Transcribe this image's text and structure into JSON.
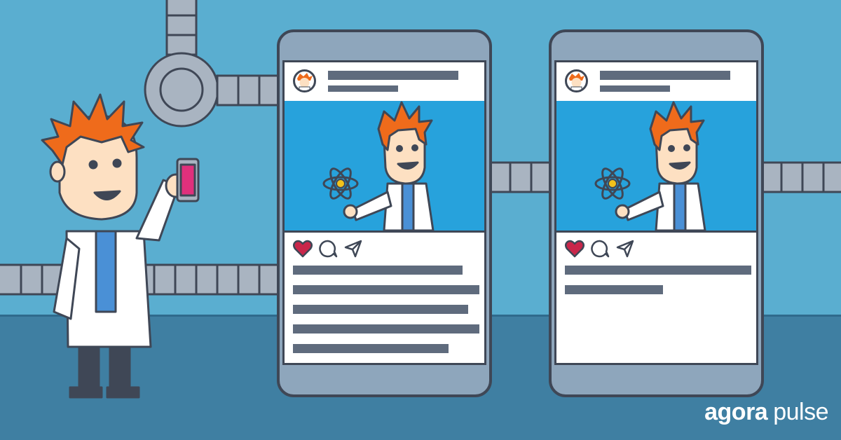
{
  "brand": {
    "part1": "agora",
    "part2": "pulse"
  },
  "icons": {
    "like": "heart-icon",
    "comment": "comment-icon",
    "share": "send-icon"
  },
  "colors": {
    "sky": "#5aaed0",
    "floor": "#3f7fa2",
    "pipe": "#a9b4c1",
    "outline": "#3f4756",
    "photo_bg": "#27a2dc",
    "heart": "#c9264a",
    "hair": "#ef6b1b",
    "phone_screen_pink": "#e0307c"
  },
  "posts": [
    {
      "caption_lines": 5,
      "liked": true
    },
    {
      "caption_lines": 2,
      "liked": true
    }
  ]
}
